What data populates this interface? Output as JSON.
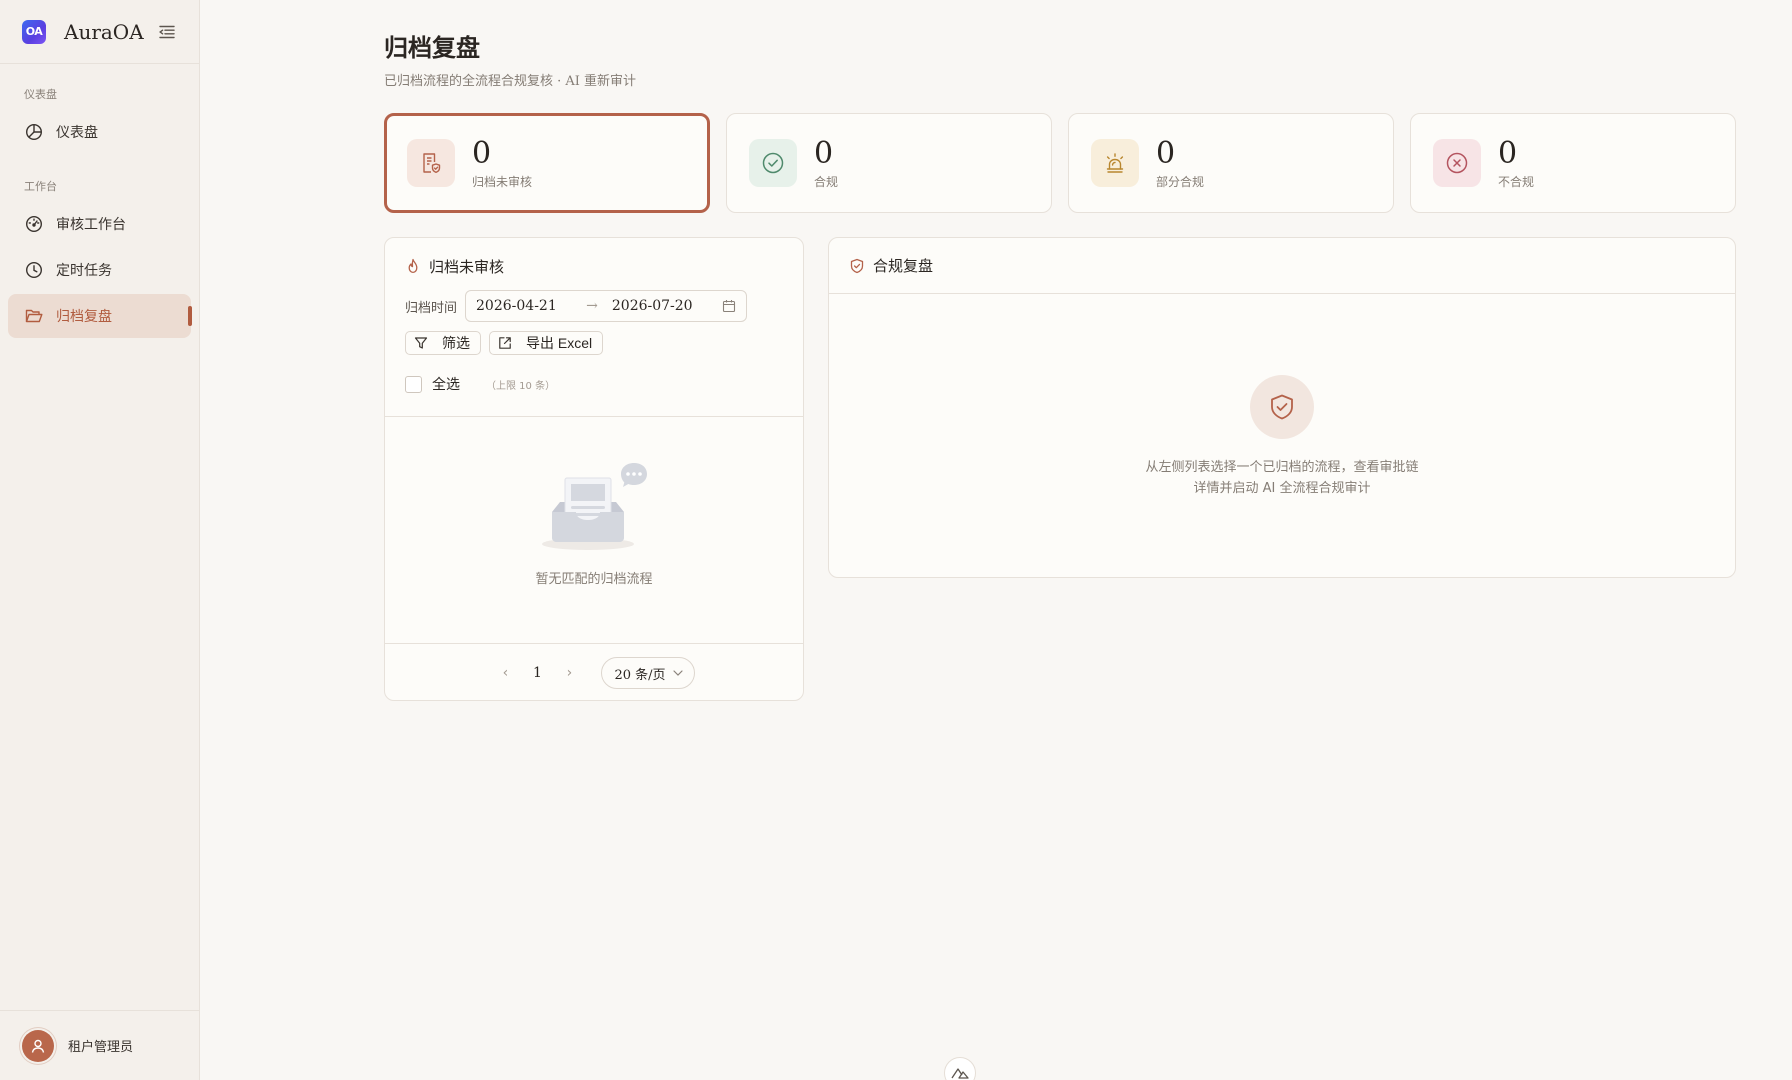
{
  "app": {
    "logo_text": "OA",
    "name": "AuraOA"
  },
  "sidebar": {
    "groups": [
      {
        "title": "仪表盘",
        "items": [
          {
            "label": "仪表盘",
            "icon": "pie-chart-icon"
          }
        ]
      },
      {
        "title": "工作台",
        "items": [
          {
            "label": "审核工作台",
            "icon": "dashboard-gauge-icon"
          },
          {
            "label": "定时任务",
            "icon": "clock-icon"
          },
          {
            "label": "归档复盘",
            "icon": "folder-open-icon",
            "active": true
          }
        ]
      }
    ],
    "user": {
      "name": "租户管理员",
      "icon": "user-icon"
    }
  },
  "page": {
    "title": "归档复盘",
    "subtitle": "已归档流程的全流程合规复核 · AI 重新审计"
  },
  "stats": [
    {
      "value": "0",
      "label": "归档未审核",
      "icon": "document-shield-icon",
      "color": "#b4624a",
      "bg": "#f6e7e0",
      "active": true
    },
    {
      "value": "0",
      "label": "合规",
      "icon": "check-circle-icon",
      "color": "#4f8a6c",
      "bg": "#e7f1ea"
    },
    {
      "value": "0",
      "label": "部分合规",
      "icon": "alarm-bell-icon",
      "color": "#b8862e",
      "bg": "#f8eedb"
    },
    {
      "value": "0",
      "label": "不合规",
      "icon": "close-circle-icon",
      "color": "#b4545f",
      "bg": "#f7e4e6"
    }
  ],
  "left_panel": {
    "title": "归档未审核",
    "filter_label": "归档时间",
    "date_start": "2026-04-21",
    "date_separator": "→",
    "date_end": "2026-07-20",
    "filter_button": "筛选",
    "export_button": "导出 Excel",
    "select_all": "全选",
    "select_hint": "（上限 10 条）",
    "empty_text": "暂无匹配的归档流程",
    "pager": {
      "prev": "‹",
      "current": "1",
      "next": "›",
      "page_size": "20 条/页"
    }
  },
  "right_panel": {
    "title": "合规复盘",
    "empty_line1": "从左侧列表选择一个已归档的流程，查看审批链",
    "empty_line2": "详情并启动 AI 全流程合规审计"
  },
  "colors": {
    "accent": "#b4624a",
    "sidebar_bg": "#f4f0eb",
    "page_bg": "#f9f7f4"
  }
}
